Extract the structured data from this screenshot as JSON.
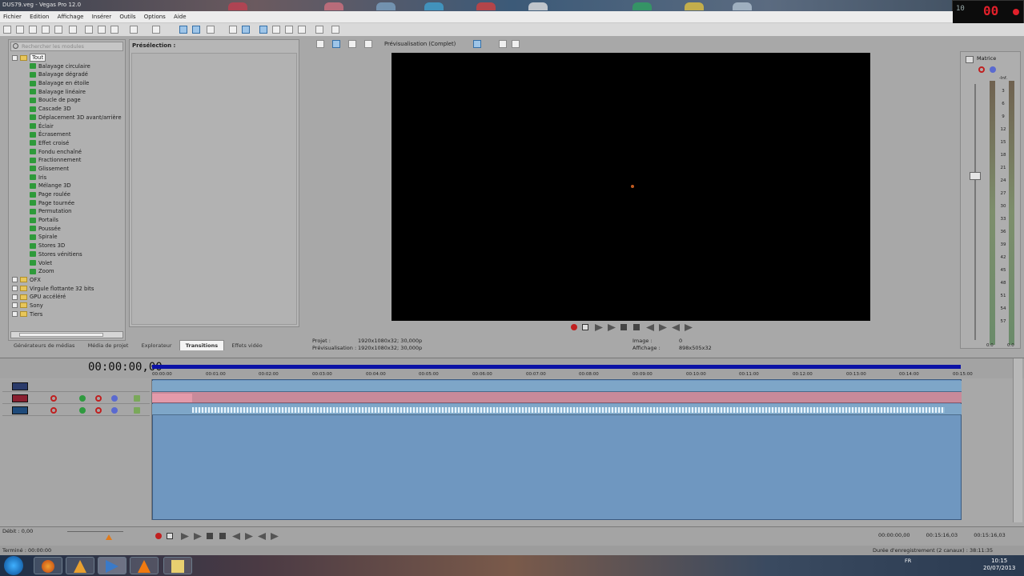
{
  "window": {
    "title": "DUS79.veg - Vegas Pro 12.0"
  },
  "menu": [
    "Fichier",
    "Edition",
    "Affichage",
    "Insérer",
    "Outils",
    "Options",
    "Aide"
  ],
  "left_panel": {
    "search_placeholder": "Rechercher les modules",
    "tree": [
      {
        "label": "Tout",
        "kind": "folder",
        "selected": true
      },
      {
        "label": "Balayage circulaire"
      },
      {
        "label": "Balayage dégradé"
      },
      {
        "label": "Balayage en étoile"
      },
      {
        "label": "Balayage linéaire"
      },
      {
        "label": "Boucle de page"
      },
      {
        "label": "Cascade 3D"
      },
      {
        "label": "Déplacement 3D avant/arrière"
      },
      {
        "label": "Éclair"
      },
      {
        "label": "Écrasement"
      },
      {
        "label": "Effet croisé"
      },
      {
        "label": "Fondu enchaîné"
      },
      {
        "label": "Fractionnement"
      },
      {
        "label": "Glissement"
      },
      {
        "label": "Iris"
      },
      {
        "label": "Mélange 3D"
      },
      {
        "label": "Page roulée"
      },
      {
        "label": "Page tournée"
      },
      {
        "label": "Permutation"
      },
      {
        "label": "Portails"
      },
      {
        "label": "Poussée"
      },
      {
        "label": "Spirale"
      },
      {
        "label": "Stores 3D"
      },
      {
        "label": "Stores vénitiens"
      },
      {
        "label": "Volet"
      },
      {
        "label": "Zoom"
      },
      {
        "label": "OFX",
        "kind": "folder"
      },
      {
        "label": "Virgule flottante 32 bits",
        "kind": "folder"
      },
      {
        "label": "GPU accéléré",
        "kind": "folder"
      },
      {
        "label": "Sony",
        "kind": "folder"
      },
      {
        "label": "Tiers",
        "kind": "folder"
      }
    ]
  },
  "preset_panel": {
    "label": "Présélection :"
  },
  "tabs": [
    {
      "label": "Générateurs de médias"
    },
    {
      "label": "Média de projet"
    },
    {
      "label": "Explorateur"
    },
    {
      "label": "Transitions",
      "active": true
    },
    {
      "label": "Effets vidéo"
    }
  ],
  "preview": {
    "mode_label": "Prévisualisation (Complet)",
    "project_label": "Projet :",
    "project_value": "1920x1080x32; 30,000p",
    "preview_label": "Prévisualisation :",
    "preview_value": "1920x1080x32; 30,000p",
    "image_label": "Image :",
    "image_value": "0",
    "display_label": "Affichage :",
    "display_value": "898x505x32"
  },
  "master": {
    "label": "Matrice",
    "scale": [
      "-Inf.",
      "3",
      "6",
      "9",
      "12",
      "15",
      "18",
      "21",
      "24",
      "27",
      "30",
      "33",
      "36",
      "39",
      "42",
      "45",
      "48",
      "51",
      "54",
      "57"
    ],
    "bottom_left": "0.0",
    "bottom_right": "0.0"
  },
  "timeline": {
    "timecode": "00:00:00,00",
    "ticks": [
      "00:00:00",
      "00:01:00",
      "00:02:00",
      "00:03:00",
      "00:04:00",
      "00:05:00",
      "00:06:00",
      "00:07:00",
      "00:08:00",
      "00:09:00",
      "00:10:00",
      "00:11:00",
      "00:12:00",
      "00:13:00",
      "00:14:00",
      "00:15:00"
    ]
  },
  "bottom": {
    "rate": "Débit : 0,00",
    "time_start": "00:00:00,00",
    "time_end": "00:15:16,03",
    "time_length": "00:15:16,03",
    "status_left": "Terminé : 00:00:00",
    "status_right": "Durée d'enregistrement (2 canaux) : 38:11:35"
  },
  "taskbar": {
    "lang": "FR",
    "time": "10:15",
    "date": "20/07/2013"
  },
  "clock_widget": {
    "small": "10",
    "big": "00"
  }
}
